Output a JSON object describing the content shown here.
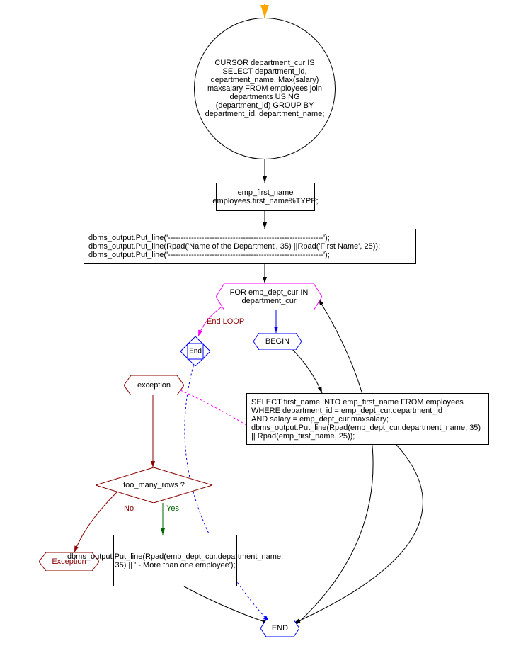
{
  "nodes": {
    "start_arrow": "start",
    "cursor_def": "CURSOR department_cur IS SELECT department_id, department_name, Max(salary) maxsalary FROM employees join departments USING (department_id) GROUP BY department_id, department_name;",
    "var_decl": "emp_first_name employees.first_name%TYPE;",
    "output_block": "dbms_output.Put_line('------------------------------------------------------------');\ndbms_output.Put_line(Rpad('Name of the Department', 35) ||Rpad('First Name', 25));\ndbms_output.Put_line('------------------------------------------------------------');",
    "for_loop": "FOR emp_dept_cur IN department_cur",
    "end_loop_label": "End LOOP",
    "end_node": "End",
    "begin_node": "BEGIN",
    "select_block": "SELECT first_name INTO emp_first_name FROM employees WHERE department_id = emp_dept_cur.department_id\nAND salary = emp_dept_cur.maxsalary;\ndbms_output.Put_line(Rpad(emp_dept_cur.department_name, 35) || Rpad(emp_first_name, 25));",
    "exception_node": "exception",
    "too_many_rows": "too_many_rows ?",
    "yes_label": "Yes",
    "no_label": "No",
    "exception_raise": "Exception",
    "output_more": "dbms_output.Put_line(Rpad(emp_dept_cur.department_name, 35) || ' - More than one employee');",
    "end_block": "END"
  },
  "colors": {
    "black": "#000000",
    "darkred": "#8B0000",
    "darkgreen": "#006400",
    "orange": "#FFA500",
    "magenta": "#FF00FF",
    "blue": "#0000FF"
  }
}
